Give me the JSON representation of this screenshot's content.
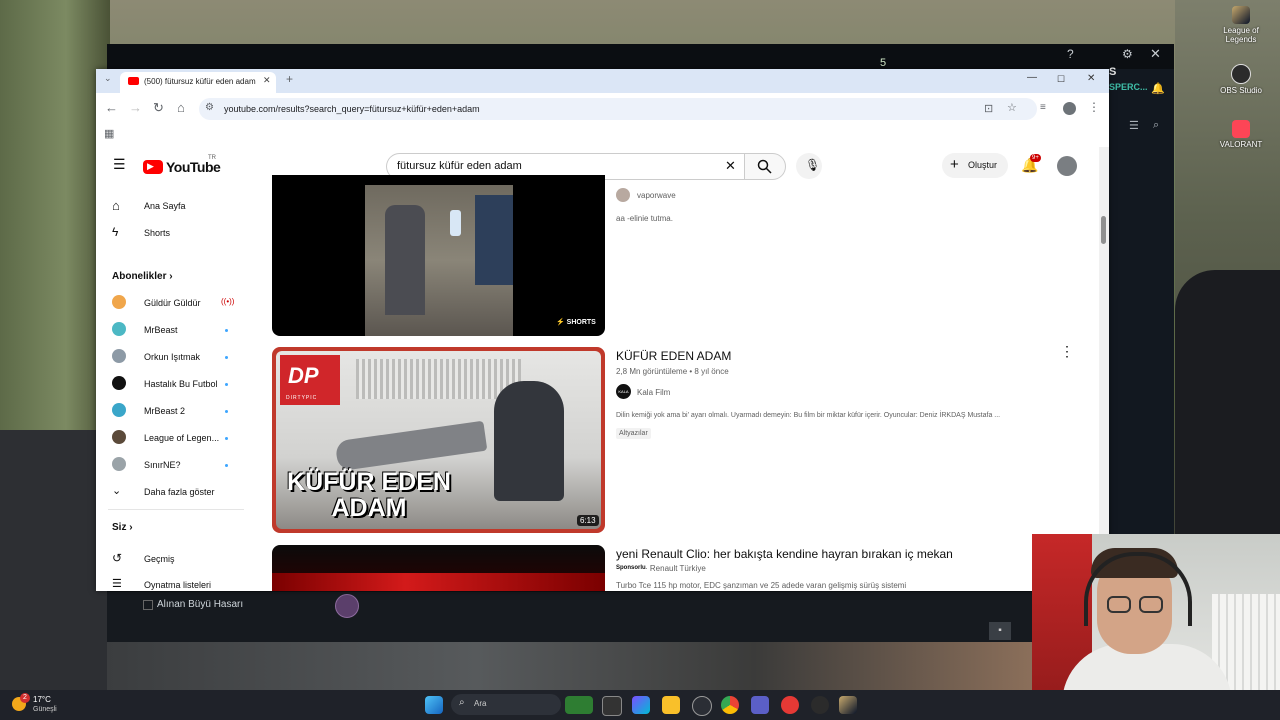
{
  "desktop": {
    "icons": [
      {
        "label": "League of Legends",
        "icon": "lol-icon"
      },
      {
        "label": "OBS Studio",
        "icon": "obs-icon"
      },
      {
        "label": "VALORANT",
        "icon": "valorant-icon"
      }
    ]
  },
  "game_window": {
    "top_partial": "S",
    "side_partial": "SPERC...",
    "counter": "5",
    "checkbox_label": "Alınan Büyü Hasarı"
  },
  "browser": {
    "tab_title": "(500) fütursuz küfür eden adam",
    "url": "youtube.com/results?search_query=fütursuz+küfür+eden+adam",
    "window_controls": [
      "—",
      "☐",
      "✕"
    ]
  },
  "youtube": {
    "logo": "YouTube",
    "logo_region": "TR",
    "search_value": "fütursuz küfür eden adam",
    "create_label": "Oluştur",
    "notification_count": "9+",
    "sidebar": {
      "main": [
        {
          "label": "Ana Sayfa",
          "icon": "home-icon"
        },
        {
          "label": "Shorts",
          "icon": "shorts-icon"
        }
      ],
      "subs_header": "Abonelikler",
      "subscriptions": [
        {
          "label": "Güldür Güldür",
          "indicator": "live",
          "color": "#f0a64b"
        },
        {
          "label": "MrBeast",
          "indicator": "dot",
          "color": "#4cb8c4"
        },
        {
          "label": "Orkun Işıtmak",
          "indicator": "dot",
          "color": "#8d9aa6"
        },
        {
          "label": "Hastalık Bu Futbol",
          "indicator": "dot",
          "color": "#111111"
        },
        {
          "label": "MrBeast 2",
          "indicator": "dot",
          "color": "#3aa6c9"
        },
        {
          "label": "League of Legen...",
          "indicator": "dot",
          "color": "#5b4a3a"
        },
        {
          "label": "SınırNE?",
          "indicator": "dot",
          "color": "#9aa3a8"
        }
      ],
      "show_more": "Daha fazla göster",
      "you_header": "Siz",
      "you_items": [
        {
          "label": "Geçmiş",
          "icon": "history-icon"
        },
        {
          "label": "Oynatma listeleri",
          "icon": "playlist-icon"
        }
      ]
    },
    "results": [
      {
        "channel": "vaporwave",
        "description": "aa -elinie tutma.",
        "badge": "SHORTS"
      },
      {
        "title": "KÜFÜR EDEN ADAM",
        "views": "2,8 Mn görüntüleme",
        "age": "8 yıl önce",
        "channel": "Kala Film",
        "channel_avatar": "KALA",
        "description": "Dilin kemiği yok ama bi' ayarı olmalı. Uyarmadı demeyin: Bu film bir miktar küfür içerir. Oyuncular: Deniz İRKDAŞ Mustafa ...",
        "tag": "Altyazılar",
        "duration": "6:13",
        "thumb_text_line1": "KÜFÜR EDEN",
        "thumb_text_line2": "ADAM",
        "thumb_logo": "DP",
        "thumb_logo_sub": "DIRTYPIC"
      },
      {
        "title": "yeni Renault Clio: her bakışta kendine hayran bırakan iç mekan",
        "sponsor": "Sponsorlu",
        "channel": "Renault Türkiye",
        "description": "Turbo Tce 115 hp motor, EDC şanzıman ve 25 adede varan gelişmiş sürüş sistemi"
      }
    ]
  },
  "taskbar": {
    "weather_temp": "17°C",
    "weather_desc": "Güneşli",
    "weather_badge": "2",
    "search_label": "Ara"
  }
}
